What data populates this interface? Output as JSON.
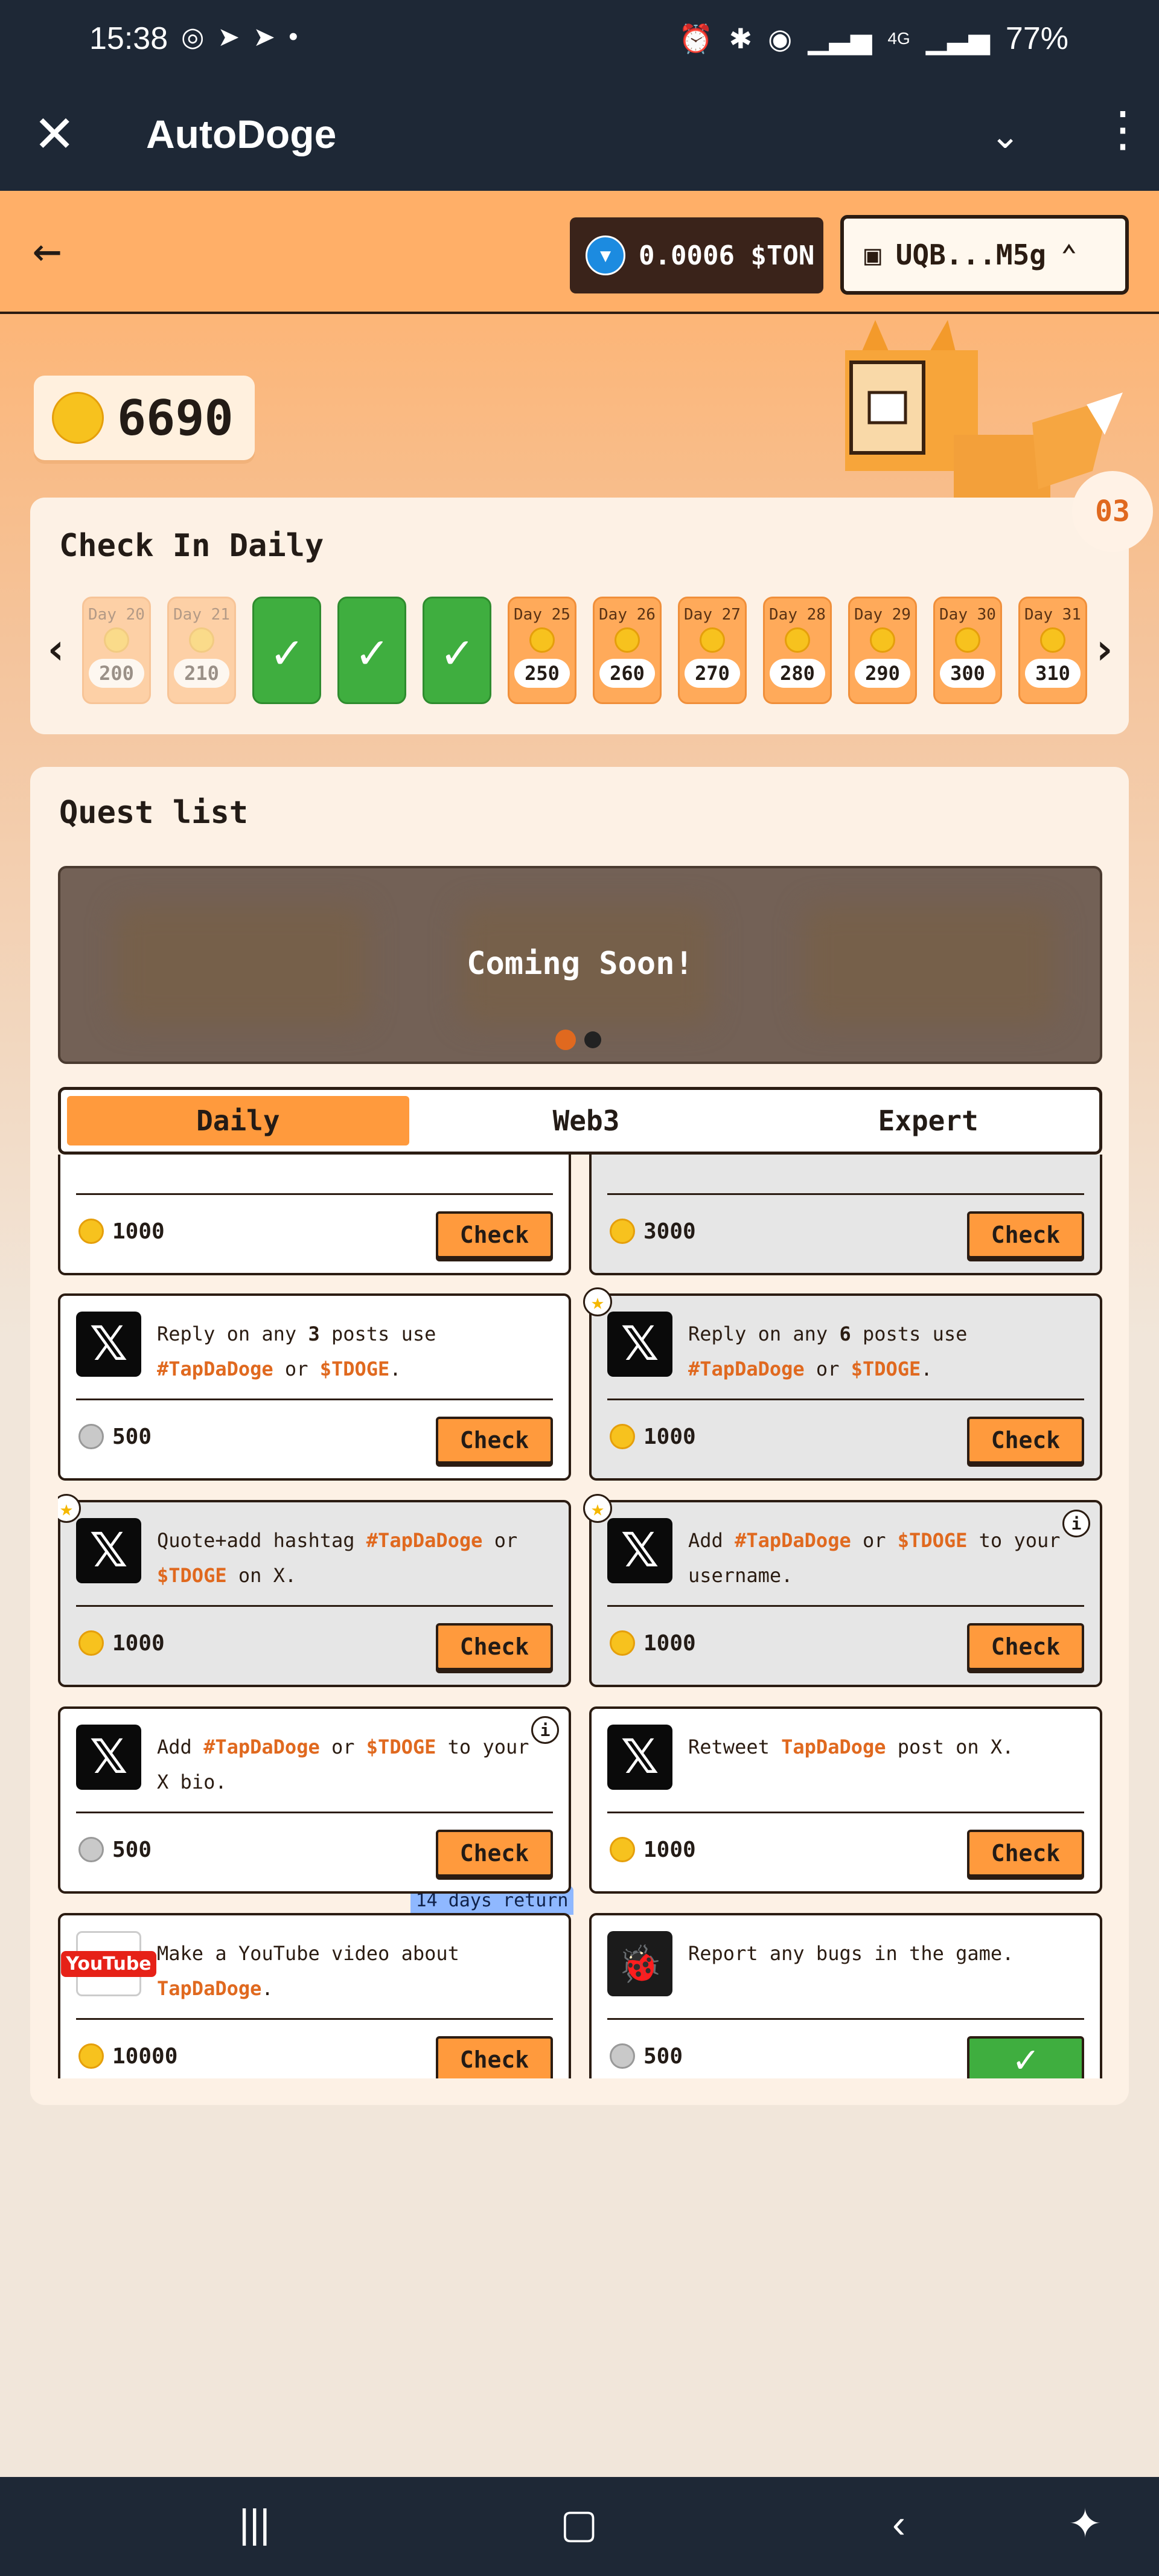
{
  "status_bar": {
    "time": "15:38",
    "left_icons": [
      "whatsapp-icon",
      "telegram-icon",
      "telegram-icon",
      "dot-icon"
    ],
    "right_icons": [
      "alarm-icon",
      "bluetooth-icon",
      "hotspot-icon",
      "volte-icon",
      "signal-icon",
      "4g-icon",
      "signal-icon"
    ],
    "network": "4G",
    "battery": "77%"
  },
  "title_bar": {
    "title": "AutoDoge"
  },
  "app_bar": {
    "ton_balance": "0.0006 $TON",
    "wallet": "UQB...M5g"
  },
  "balance": {
    "value": "6690"
  },
  "checkin": {
    "title": "Check In Daily",
    "badge": "03",
    "days": [
      {
        "label": "Day 20",
        "amount": "200",
        "state": "faded"
      },
      {
        "label": "Day 21",
        "amount": "210",
        "state": "faded"
      },
      {
        "label": "",
        "amount": "",
        "state": "done"
      },
      {
        "label": "",
        "amount": "",
        "state": "done"
      },
      {
        "label": "",
        "amount": "",
        "state": "done"
      },
      {
        "label": "Day 25",
        "amount": "250",
        "state": "pending"
      },
      {
        "label": "Day 26",
        "amount": "260",
        "state": "pending"
      },
      {
        "label": "Day 27",
        "amount": "270",
        "state": "pending"
      },
      {
        "label": "Day 28",
        "amount": "280",
        "state": "pending"
      },
      {
        "label": "Day 29",
        "amount": "290",
        "state": "pending"
      },
      {
        "label": "Day 30",
        "amount": "300",
        "state": "pending"
      },
      {
        "label": "Day 31",
        "amount": "310",
        "state": "pending"
      }
    ]
  },
  "quests": {
    "title": "Quest list",
    "banner_text": "Coming Soon!",
    "tabs": [
      "Daily",
      "Web3",
      "Expert"
    ],
    "active_tab": "Daily",
    "check_label": "Check",
    "return_badge": "14 days return",
    "items": [
      {
        "reward": "1000",
        "coin": "gold"
      },
      {
        "reward": "3000",
        "coin": "gold"
      },
      {
        "icon": "X",
        "reward": "500",
        "coin": "silver",
        "parts": [
          "Reply on any ",
          "3",
          " posts use ",
          "#TapDaDoge",
          " or ",
          "$TDOGE",
          "."
        ]
      },
      {
        "icon": "X",
        "reward": "1000",
        "coin": "gold",
        "parts": [
          "Reply on any ",
          "6",
          " posts use ",
          "#TapDaDoge",
          " or ",
          "$TDOGE",
          "."
        ]
      },
      {
        "icon": "X",
        "reward": "1000",
        "coin": "gold",
        "parts": [
          "Quote+add hashtag ",
          "#TapDaDoge",
          " or ",
          "$TDOGE",
          " on X."
        ]
      },
      {
        "icon": "X",
        "reward": "1000",
        "coin": "gold",
        "parts": [
          "Add ",
          "#TapDaDoge",
          " or ",
          "$TDOGE",
          " to your username."
        ]
      },
      {
        "icon": "X",
        "reward": "500",
        "coin": "silver",
        "parts": [
          "Add ",
          "#TapDaDoge",
          " or ",
          "$TDOGE",
          " to your X bio."
        ]
      },
      {
        "icon": "X",
        "reward": "1000",
        "coin": "gold",
        "parts": [
          "Retweet ",
          "TapDaDoge",
          " post on X."
        ]
      },
      {
        "icon": "YouTube",
        "reward": "10000",
        "coin": "gold",
        "parts": [
          "Make a YouTube video about ",
          "TapDaDoge",
          "."
        ]
      },
      {
        "icon": "bug",
        "reward": "500",
        "coin": "silver",
        "parts": [
          "Report any bugs in the game."
        ]
      }
    ]
  },
  "colors": {
    "accent_orange": "#ff9a3d",
    "highlight_orange": "#e0691f",
    "done_green": "#3fae3f",
    "dark": "#1e2836"
  }
}
